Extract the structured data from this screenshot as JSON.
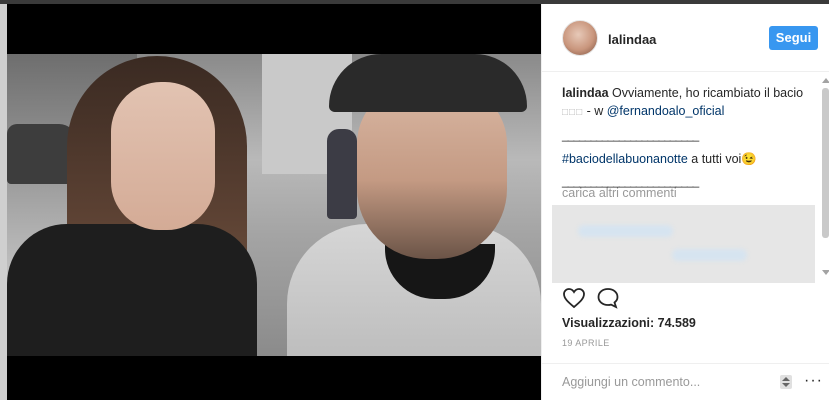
{
  "post": {
    "username": "lalindaa",
    "follow_label": "Segui",
    "caption_user": "lalindaa",
    "caption_text": " Ovviamente, ho ricambiato il bacio ",
    "caption_glyphs": "□□□",
    "caption_w": " - w  ",
    "caption_mention": "@fernandoalo_oficial",
    "separator": "________________________",
    "hashtag": "#baciodellabuonanotte",
    "hashtag_tail": " a tutti voi",
    "emoji": "😉",
    "load_more": "carica altri commenti",
    "views_label": "Visualizzazioni: 74.589",
    "date": "19 APRILE",
    "add_comment_placeholder": "Aggiungi un commento...",
    "more_glyph": "···"
  },
  "icons": {
    "heart": "heart-icon",
    "comment": "comment-icon",
    "stepper": "stepper-icon",
    "more": "more-options-icon"
  },
  "colors": {
    "follow_button": "#3897f0",
    "link": "#003569",
    "muted": "#999999"
  }
}
